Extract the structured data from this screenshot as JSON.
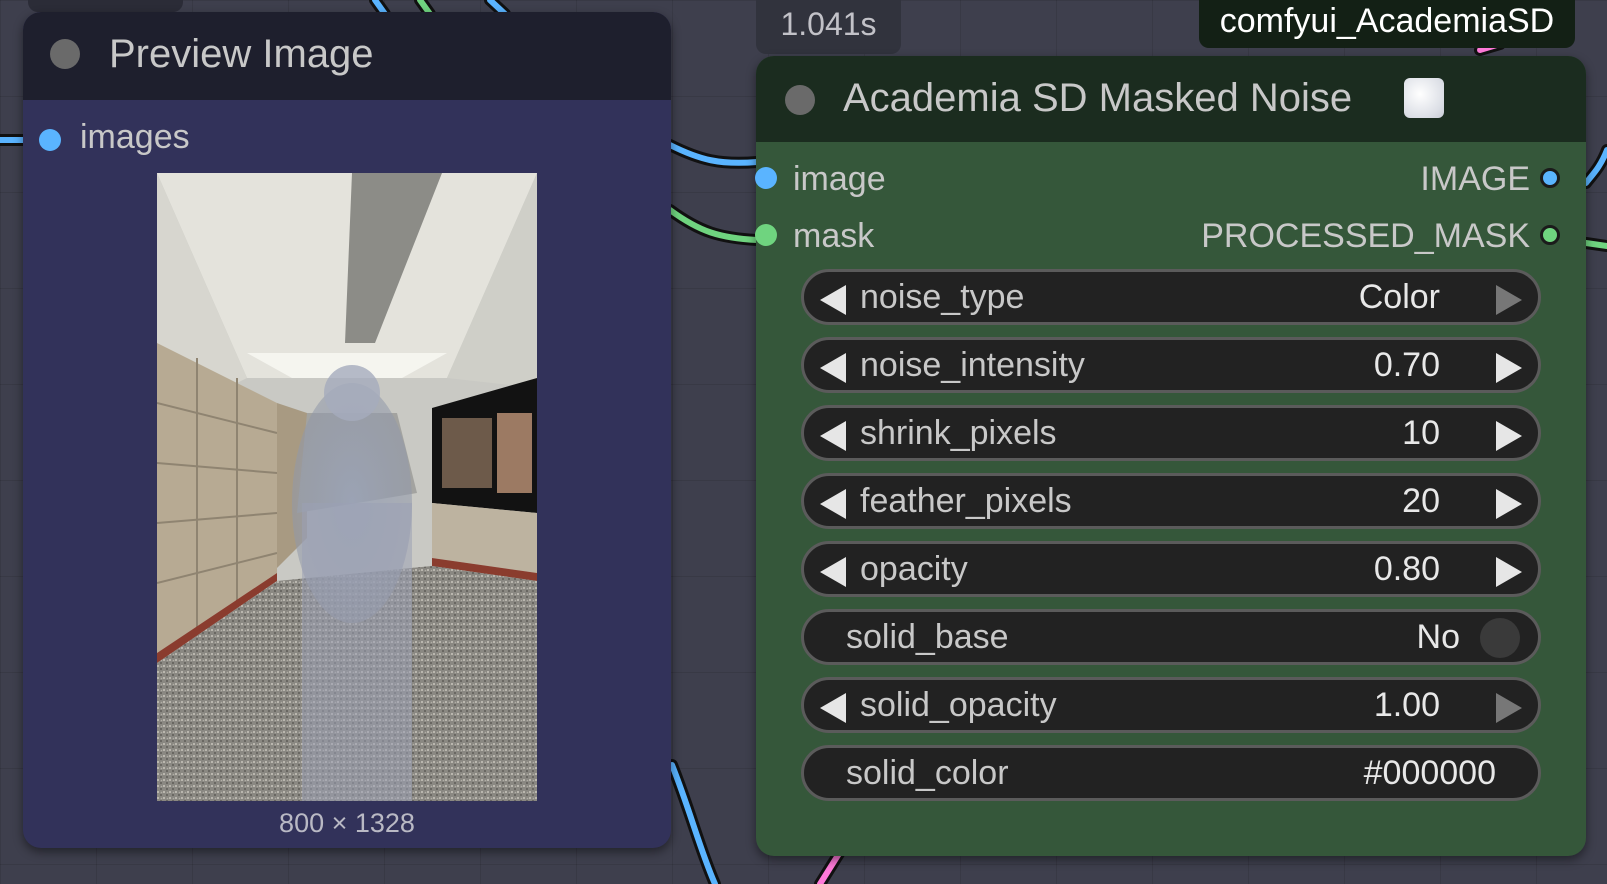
{
  "timing_badge": "1.041s",
  "group_badge": "comfyui_AcademiaSD",
  "preview_node": {
    "title": "Preview Image",
    "input": "images",
    "image_size": "800 × 1328"
  },
  "noise_node": {
    "title": "Academia SD Masked Noise",
    "inputs": [
      {
        "label": "image"
      },
      {
        "label": "mask"
      }
    ],
    "outputs": [
      {
        "label": "IMAGE"
      },
      {
        "label": "PROCESSED_MASK"
      }
    ],
    "widgets": {
      "noise_type": {
        "label": "noise_type",
        "value": "Color"
      },
      "noise_intensity": {
        "label": "noise_intensity",
        "value": "0.70"
      },
      "shrink_pixels": {
        "label": "shrink_pixels",
        "value": "10"
      },
      "feather_pixels": {
        "label": "feather_pixels",
        "value": "20"
      },
      "opacity": {
        "label": "opacity",
        "value": "0.80"
      },
      "solid_base": {
        "label": "solid_base",
        "value": "No"
      },
      "solid_opacity": {
        "label": "solid_opacity",
        "value": "1.00"
      },
      "solid_color": {
        "label": "solid_color",
        "value": "#000000"
      }
    }
  },
  "colors": {
    "image_slot": "#5ab4ff",
    "mask_slot": "#6fd47f",
    "link_pink": "#ff7ad9",
    "preview_body": "#32325a",
    "noise_body": "#35573a"
  }
}
